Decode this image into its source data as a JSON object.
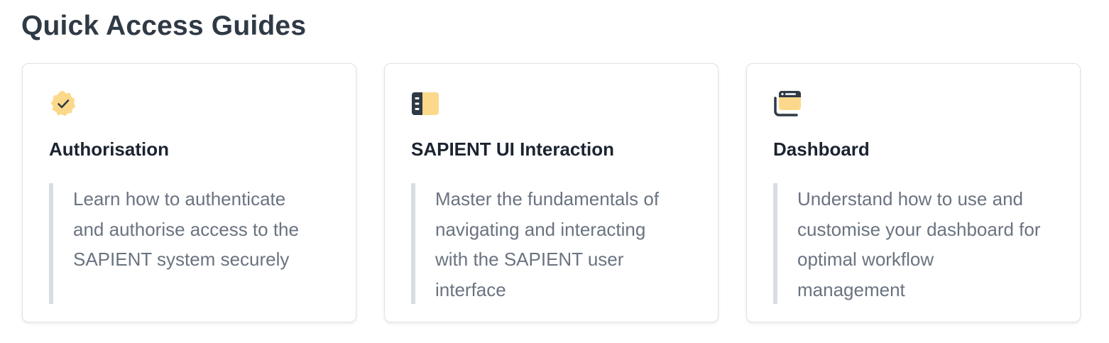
{
  "section": {
    "title": "Quick Access Guides"
  },
  "cards": [
    {
      "icon": "verified-badge-icon",
      "title": "Authorisation",
      "description": "Learn how to authenticate and authorise access to the SAPIENT system securely"
    },
    {
      "icon": "sidebar-panel-icon",
      "title": "SAPIENT UI Interaction",
      "description": "Master the fundamentals of navigating and interacting with the SAPIENT user interface"
    },
    {
      "icon": "browser-window-icon",
      "title": "Dashboard",
      "description": "Understand how to use and customise your dashboard for optimal workflow management"
    }
  ],
  "colors": {
    "accent": "#fcd98a",
    "icon_dark": "#2f3a45",
    "quote_bar": "#d9dde2"
  }
}
